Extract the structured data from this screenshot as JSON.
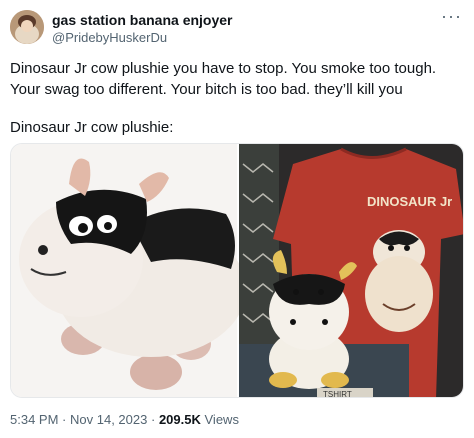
{
  "tweet": {
    "display_name": "gas station banana enjoyer",
    "handle": "@PridebyHuskerDu",
    "more_icon": "more-horizontal-icon",
    "text_line_1": "Dinosaur Jr cow plushie you have to stop. You smoke too tough. Your swag too different. Your bitch is too bad. they’ll kill you",
    "text_line_2": "Dinosaur Jr cow plushie:",
    "time": "5:34 PM",
    "separator": "·",
    "date": "Nov 14, 2023",
    "views_count": "209.5K",
    "views_label": "Views"
  },
  "media": {
    "shirt_text": "DINOSAUR Jr",
    "tag_text": "TSHIRT"
  },
  "colors": {
    "text_primary": "#0f1419",
    "text_secondary": "#536471",
    "shirt_red": "#b73a2e"
  }
}
